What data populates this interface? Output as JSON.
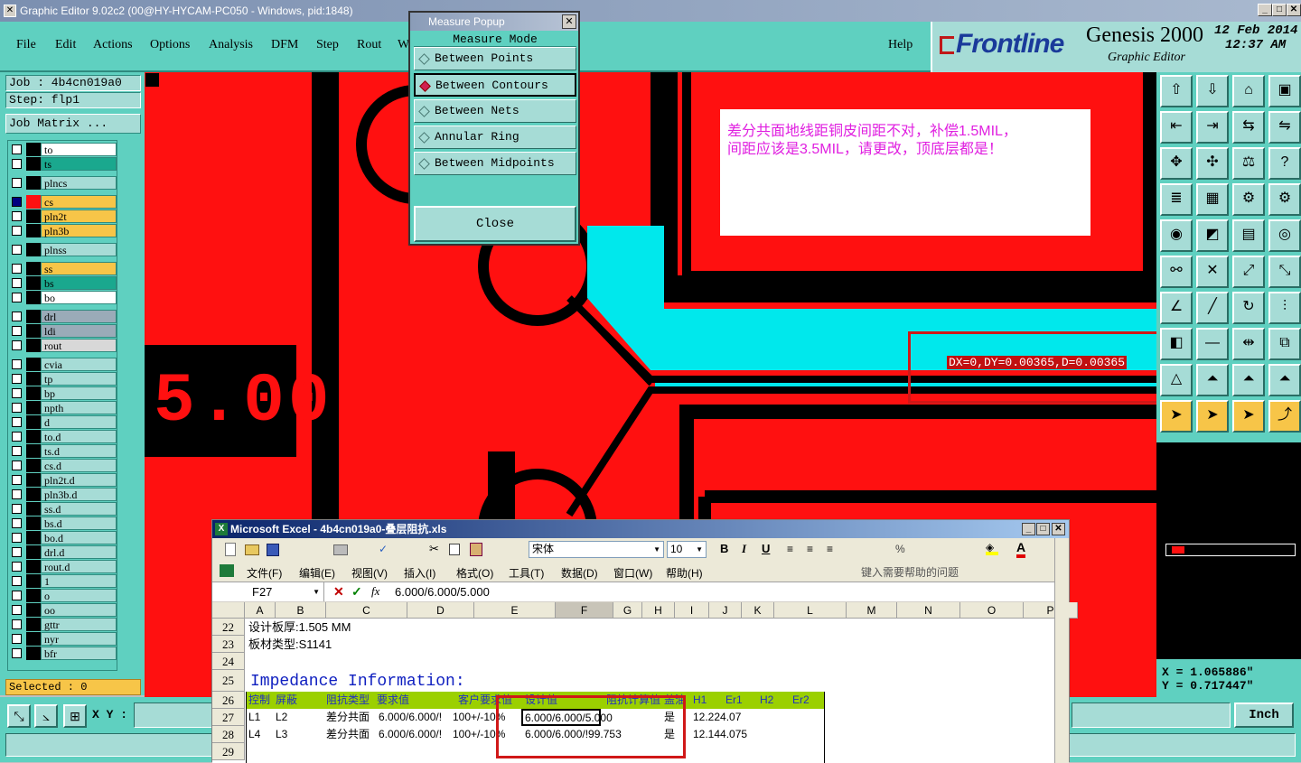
{
  "titlebar": {
    "title": "Graphic Editor 9.02c2 (00@HY-HYCAM-PC050 - Windows, pid:1848)",
    "min": "_",
    "max": "□",
    "close": "✕"
  },
  "menu": {
    "items": [
      "File",
      "Edit",
      "Actions",
      "Options",
      "Analysis",
      "DFM",
      "Step",
      "Rout",
      "W"
    ],
    "help": "Help"
  },
  "logo": {
    "brand": "Frontline",
    "product": "Genesis 2000",
    "subtitle": "Graphic Editor",
    "date": "12 Feb 2014",
    "time": "12:37 AM"
  },
  "job": {
    "job_label": "Job : 4b4cn019a0",
    "step_label": "Step: flp1",
    "matrix_button": "Job Matrix ..."
  },
  "layers": [
    {
      "name": "to",
      "color": "#ffffff",
      "gap": false
    },
    {
      "name": "ts",
      "color": "#1aa88e",
      "gap": false
    },
    {
      "name": "plncs",
      "color": "#a6dcd6",
      "gap": true
    },
    {
      "name": "cs",
      "color": "#f7c548",
      "gap": true,
      "active": true
    },
    {
      "name": "pln2t",
      "color": "#f7c548",
      "gap": false
    },
    {
      "name": "pln3b",
      "color": "#f7c548",
      "gap": false
    },
    {
      "name": "plnss",
      "color": "#a6dcd6",
      "gap": true
    },
    {
      "name": "ss",
      "color": "#f7c548",
      "gap": true
    },
    {
      "name": "bs",
      "color": "#1aa88e",
      "gap": false
    },
    {
      "name": "bo",
      "color": "#ffffff",
      "gap": false
    },
    {
      "name": "drl",
      "color": "#9aabb8",
      "gap": true
    },
    {
      "name": "ldi",
      "color": "#9aabb8",
      "gap": false
    },
    {
      "name": "rout",
      "color": "#d8d8d8",
      "gap": false
    },
    {
      "name": "cvia",
      "color": "#a6dcd6",
      "gap": true
    },
    {
      "name": "tp",
      "color": "#a6dcd6",
      "gap": false
    },
    {
      "name": "bp",
      "color": "#a6dcd6",
      "gap": false
    },
    {
      "name": "npth",
      "color": "#a6dcd6",
      "gap": false
    },
    {
      "name": "d",
      "color": "#a6dcd6",
      "gap": false
    },
    {
      "name": "to.d",
      "color": "#a6dcd6",
      "gap": false
    },
    {
      "name": "ts.d",
      "color": "#a6dcd6",
      "gap": false
    },
    {
      "name": "cs.d",
      "color": "#a6dcd6",
      "gap": false
    },
    {
      "name": "pln2t.d",
      "color": "#a6dcd6",
      "gap": false
    },
    {
      "name": "pln3b.d",
      "color": "#a6dcd6",
      "gap": false
    },
    {
      "name": "ss.d",
      "color": "#a6dcd6",
      "gap": false
    },
    {
      "name": "bs.d",
      "color": "#a6dcd6",
      "gap": false
    },
    {
      "name": "bo.d",
      "color": "#a6dcd6",
      "gap": false
    },
    {
      "name": "drl.d",
      "color": "#a6dcd6",
      "gap": false
    },
    {
      "name": "rout.d",
      "color": "#a6dcd6",
      "gap": false
    },
    {
      "name": "1",
      "color": "#a6dcd6",
      "gap": false
    },
    {
      "name": "o",
      "color": "#a6dcd6",
      "gap": false
    },
    {
      "name": "oo",
      "color": "#a6dcd6",
      "gap": false
    },
    {
      "name": "gttr",
      "color": "#a6dcd6",
      "gap": false
    },
    {
      "name": "nyr",
      "color": "#a6dcd6",
      "gap": false
    },
    {
      "name": "bfr",
      "color": "#a6dcd6",
      "gap": false
    }
  ],
  "status": {
    "selected": "Selected : 0",
    "xy_label": "X Y :",
    "units": "Inch"
  },
  "popup": {
    "title": "Measure Popup",
    "close_x": "✕",
    "header": "Measure Mode",
    "options": [
      "Between Points",
      "Between Contours",
      "Between Nets",
      "Annular Ring",
      "Between Midpoints"
    ],
    "selected": "Between Contours",
    "close_button": "Close"
  },
  "canvas": {
    "note_line1": "差分共面地线距铜皮间距不对，补偿1.5MIL，",
    "note_line2": "间距应该是3.5MIL，请更改，顶底层都是！",
    "measure_text": "DX=0,DY=0.00365,D=0.00365",
    "big_text": "5.00"
  },
  "coords": {
    "x": "X  = 1.065886\"",
    "y": "Y  = 0.717447\""
  },
  "excel": {
    "title": "Microsoft Excel - 4b4cn019a0-叠层阻抗.xls",
    "font": "宋体",
    "size": "10",
    "menus": [
      "文件(F)",
      "编辑(E)",
      "视图(V)",
      "插入(I)",
      "格式(O)",
      "工具(T)",
      "数据(D)",
      "窗口(W)",
      "帮助(H)"
    ],
    "help_placeholder": "键入需要帮助的问题",
    "cell_ref": "F27",
    "formula": "6.000/6.000/5.000",
    "columns": [
      "A",
      "B",
      "C",
      "D",
      "E",
      "F",
      "G",
      "H",
      "I",
      "J",
      "K",
      "L",
      "M",
      "N",
      "O",
      "P"
    ],
    "rows": {
      "r22": {
        "num": "22",
        "text": "设计板厚:1.505 MM"
      },
      "r23": {
        "num": "23",
        "text": "板材类型:S1141"
      },
      "r24": {
        "num": "24",
        "text": ""
      },
      "r25": {
        "num": "25",
        "text": "Impedance Information:"
      },
      "r26": {
        "num": "26",
        "cells": [
          "控制",
          "屏蔽",
          "阻抗类型",
          "要求值",
          "客户要求值",
          "设计值",
          "阻抗计算值",
          "盖油",
          "H1",
          "Er1",
          "H2",
          "Er2"
        ]
      },
      "r27": {
        "num": "27",
        "cells": [
          "L1",
          "L2",
          "差分共面",
          "6.000/6.000/!",
          "100+/-10%",
          "6.000/6.000/5.000",
          "",
          "是",
          "12.224.07"
        ]
      },
      "r28": {
        "num": "28",
        "cells": [
          "L4",
          "L3",
          "差分共面",
          "6.000/6.000/!",
          "100+/-10%",
          "6.000/6.000/!99.753",
          "",
          "是",
          "12.144.075"
        ]
      },
      "r29": {
        "num": "29",
        "text": ""
      }
    }
  }
}
